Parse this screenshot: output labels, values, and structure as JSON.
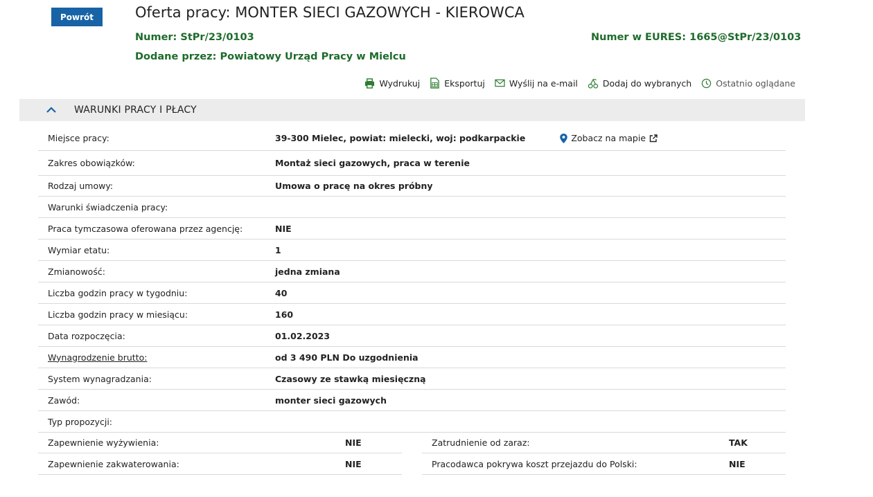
{
  "header": {
    "back_label": "Powrót",
    "title": "Oferta pracy: MONTER SIECI GAZOWYCH - KIEROWCA",
    "number_label": "Numer:",
    "number_value": "StPr/23/0103",
    "eures_label": "Numer w EURES:",
    "eures_value": "1665@StPr/23/0103",
    "added_label": "Dodane przez:",
    "added_value": "Powiatowy Urząd Pracy w Mielcu"
  },
  "toolbar": {
    "print": "Wydrukuj",
    "export": "Eksportuj",
    "email": "Wyślij na e-mail",
    "favorites": "Dodaj do wybranych",
    "recent": "Ostatnio oglądane"
  },
  "section": {
    "title": "WARUNKI PRACY I PŁACY"
  },
  "rows": [
    {
      "label": "Miejsce pracy:",
      "value": "39-300 Mielec, powiat: mielecki, woj: podkarpackie"
    },
    {
      "label": "Zakres obowiązków:",
      "value": "Montaż sieci gazowych, praca w terenie"
    },
    {
      "label": "Rodzaj umowy:",
      "value": "Umowa o pracę na okres próbny"
    },
    {
      "label": "Warunki świadczenia pracy:",
      "value": ""
    },
    {
      "label": "Praca tymczasowa oferowana przez agencję:",
      "value": "NIE"
    },
    {
      "label": "Wymiar etatu:",
      "value": "1"
    },
    {
      "label": "Zmianowość:",
      "value": "jedna zmiana"
    },
    {
      "label": "Liczba godzin pracy w tygodniu:",
      "value": "40"
    },
    {
      "label": "Liczba godzin pracy w miesiącu:",
      "value": "160"
    },
    {
      "label": "Data rozpoczęcia:",
      "value": "01.02.2023"
    },
    {
      "label": "Wynagrodzenie brutto:",
      "value": "od 3 490 PLN Do uzgodnienia"
    },
    {
      "label": "System wynagradzania:",
      "value": "Czasowy ze stawką miesięczną"
    },
    {
      "label": "Zawód:",
      "value": "monter sieci gazowych"
    },
    {
      "label": "Typ propozycji:",
      "value": ""
    }
  ],
  "map_link": "Zobacz na mapie",
  "pairs": [
    {
      "left_label": "Zapewnienie wyżywienia:",
      "left_value": "NIE",
      "right_label": "Zatrudnienie od zaraz:",
      "right_value": "TAK"
    },
    {
      "left_label": "Zapewnienie zakwaterowania:",
      "left_value": "NIE",
      "right_label": "Pracodawca pokrywa koszt przejazdu do Polski:",
      "right_value": "NIE"
    }
  ],
  "colors": {
    "primary_blue": "#1763a6",
    "green_text": "#1e6b2b",
    "section_bg": "#ececec"
  }
}
